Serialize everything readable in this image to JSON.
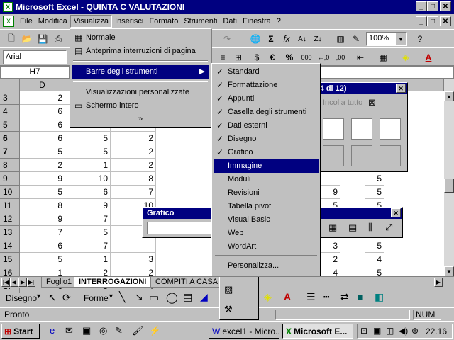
{
  "window": {
    "title": "Microsoft Excel - QUINTA C VALUTAZIONI",
    "minimize": "_",
    "maximize": "□",
    "close": "✕",
    "doc_min": "_",
    "doc_max": "□",
    "doc_close": "✕"
  },
  "menubar": [
    "File",
    "Modifica",
    "Visualizza",
    "Inserisci",
    "Formato",
    "Strumenti",
    "Dati",
    "Finestra",
    "?"
  ],
  "toolbar": {
    "font": "Arial",
    "zoom": "100%"
  },
  "namebox": "H7",
  "columns": [
    "D"
  ],
  "rows": [
    {
      "n": "3",
      "d": "2",
      "e": "",
      "f": "",
      "bold": false
    },
    {
      "n": "4",
      "d": "6",
      "e": "",
      "f": "",
      "bold": false
    },
    {
      "n": "5",
      "d": "6",
      "e": "",
      "f": "",
      "bold": false
    },
    {
      "n": "6",
      "d": "6",
      "e": "5",
      "f": "2",
      "bold": true
    },
    {
      "n": "7",
      "d": "5",
      "e": "5",
      "f": "2",
      "bold": true
    },
    {
      "n": "8",
      "d": "2",
      "e": "1",
      "f": "2",
      "bold": false
    },
    {
      "n": "9",
      "d": "9",
      "e": "10",
      "f": "8",
      "bold": false
    },
    {
      "n": "10",
      "d": "5",
      "e": "6",
      "f": "7",
      "bold": false
    },
    {
      "n": "11",
      "d": "8",
      "e": "9",
      "f": "10",
      "bold": false
    },
    {
      "n": "12",
      "d": "9",
      "e": "7",
      "f": "",
      "bold": false
    },
    {
      "n": "13",
      "d": "7",
      "e": "5",
      "f": "",
      "bold": false
    },
    {
      "n": "14",
      "d": "6",
      "e": "7",
      "f": "",
      "bold": false
    },
    {
      "n": "15",
      "d": "5",
      "e": "1",
      "f": "3",
      "bold": false
    },
    {
      "n": "16",
      "d": "1",
      "e": "2",
      "f": "2",
      "bold": false
    },
    {
      "n": "17",
      "d": "6",
      "e": "5",
      "f": "4",
      "bold": false
    }
  ],
  "right_cells": [
    {
      "row": 9,
      "a": "",
      "b": "5"
    },
    {
      "row": 10,
      "a": "9",
      "b": "5"
    },
    {
      "row": 11,
      "a": "5",
      "b": "5"
    },
    {
      "row": 12,
      "a": "",
      "b": "5"
    },
    {
      "row": 13,
      "a": "",
      "b": "5"
    },
    {
      "row": 14,
      "a": "3",
      "b": "5"
    },
    {
      "row": 15,
      "a": "2",
      "b": "4"
    },
    {
      "row": 16,
      "a": "4",
      "b": "5"
    }
  ],
  "visualizza_menu": [
    {
      "label": "Normale",
      "icon": "normal-view-icon"
    },
    {
      "label": "Anteprima interruzioni di pagina",
      "icon": "page-break-icon"
    },
    {
      "label": "Barre degli strumenti",
      "icon": "",
      "submenu": true
    },
    {
      "label": "Visualizzazioni personalizzate",
      "icon": ""
    },
    {
      "label": "Schermo intero",
      "icon": "fullscreen-icon"
    },
    {
      "label": "»",
      "icon": ""
    }
  ],
  "toolbars_submenu": [
    {
      "label": "Standard",
      "checked": true
    },
    {
      "label": "Formattazione",
      "checked": true
    },
    {
      "label": "Appunti",
      "checked": true
    },
    {
      "label": "Casella degli strumenti",
      "checked": true
    },
    {
      "label": "Dati esterni",
      "checked": true
    },
    {
      "label": "Disegno",
      "checked": true
    },
    {
      "label": "Grafico",
      "checked": true
    },
    {
      "label": "Immagine",
      "checked": false,
      "highlight": true
    },
    {
      "label": "Moduli",
      "checked": false
    },
    {
      "label": "Revisioni",
      "checked": false
    },
    {
      "label": "Tabella pivot",
      "checked": false
    },
    {
      "label": "Visual Basic",
      "checked": false
    },
    {
      "label": "Web",
      "checked": false
    },
    {
      "label": "WordArt",
      "checked": false
    },
    {
      "label": "Personalizza...",
      "checked": false
    }
  ],
  "clipboard_palette": {
    "title": "(4 di 12)",
    "paste_all": "Incolla tutto"
  },
  "chart_palette": {
    "title": "Grafico"
  },
  "sheet_tabs": [
    "Foglio1",
    "INTERROGAZIONI",
    "COMPITI A CASA"
  ],
  "drawbar": {
    "disegno": "Disegno",
    "forme": "Forme"
  },
  "status": {
    "text": "Pronto",
    "num": "NUM"
  },
  "taskbar": {
    "start": "Start",
    "task1": "excel1 - Micro...",
    "task2": "Microsoft E...",
    "clock": "22.16"
  }
}
